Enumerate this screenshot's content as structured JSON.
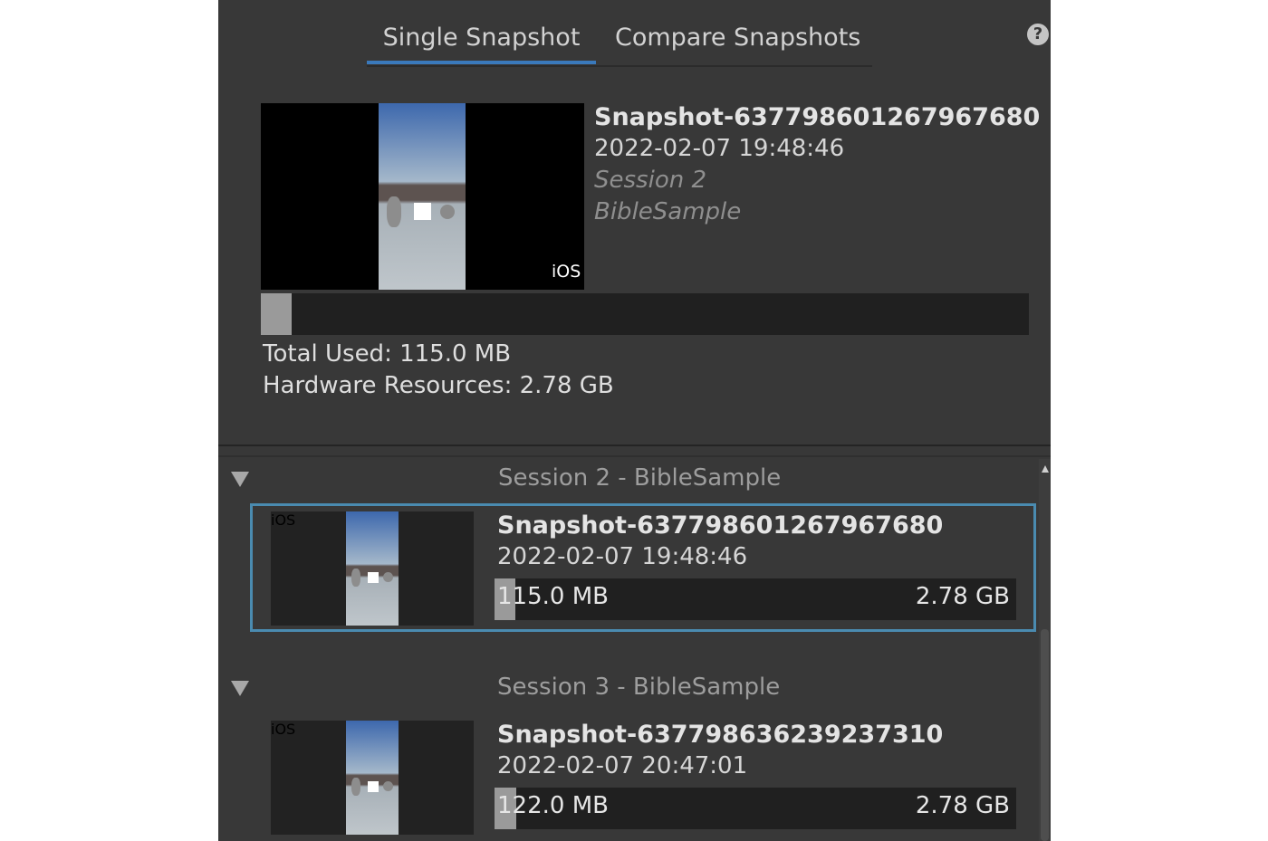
{
  "tabs": {
    "single": "Single Snapshot",
    "compare": "Compare Snapshots",
    "active": "Single Snapshot"
  },
  "help": {
    "glyph": "?"
  },
  "selected_snapshot": {
    "name": "Snapshot-637798601267967680",
    "date": "2022-02-07 19:48:46",
    "session": "Session 2",
    "project": "BibleSample",
    "platform": "iOS",
    "total_used_label": "Total Used: 115.0 MB",
    "hardware_label": "Hardware Resources: 2.78 GB",
    "usage_fraction": 0.04
  },
  "sessions": [
    {
      "title": "Session 2 - BibleSample",
      "snapshots": [
        {
          "name": "Snapshot-637798601267967680",
          "date": "2022-02-07 19:48:46",
          "used": "115.0 MB",
          "total": "2.78 GB",
          "platform": "iOS",
          "usage_fraction": 0.04,
          "selected": true
        }
      ]
    },
    {
      "title": "Session 3 - BibleSample",
      "snapshots": [
        {
          "name": "Snapshot-637798636239237310",
          "date": "2022-02-07 20:47:01",
          "used": "122.0 MB",
          "total": "2.78 GB",
          "platform": "iOS",
          "usage_fraction": 0.043,
          "selected": false
        }
      ]
    }
  ],
  "colors": {
    "panel_bg": "#383838",
    "tab_underline": "#3a79bb",
    "selection_border": "#4a8bb0",
    "bar_bg": "#202020",
    "bar_fill": "#9a9a9a"
  }
}
